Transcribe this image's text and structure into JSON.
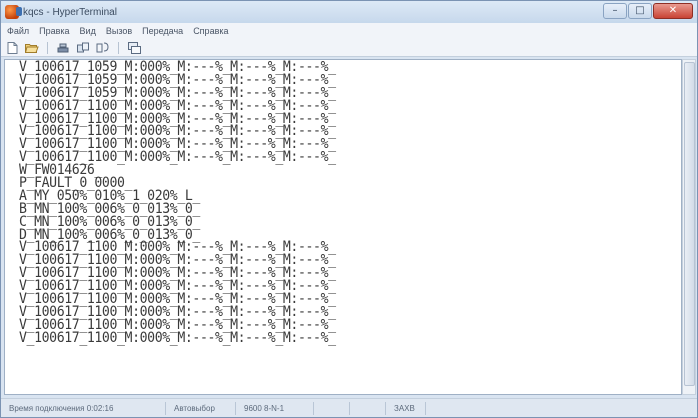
{
  "window": {
    "title": "kqcs - HyperTerminal"
  },
  "menu": [
    "Файл",
    "Правка",
    "Вид",
    "Вызов",
    "Передача",
    "Справка"
  ],
  "toolbar": {
    "icons": [
      "new-icon",
      "open-icon",
      "disconnect-icon",
      "call-icon",
      "send-icon",
      "properties-icon"
    ]
  },
  "terminal": {
    "lines": [
      "V_100617_1059_M:000%_M:---%_M:---%_M:---%_",
      "V_100617_1059_M:000%_M:---%_M:---%_M:---%_",
      "V_100617_1059_M:000%_M:---%_M:---%_M:---%_",
      "V_100617_1100_M:000%_M:---%_M:---%_M:---%_",
      "V_100617_1100_M:000%_M:---%_M:---%_M:---%_",
      "V_100617_1100_M:000%_M:---%_M:---%_M:---%_",
      "V_100617_1100_M:000%_M:---%_M:---%_M:---%_",
      "V_100617_1100_M:000%_M:---%_M:---%_M:---%_",
      "W_FW014626_",
      "P_FAULT_0_0000_",
      "A_MY_050%_010%_1_020%_L_",
      "B_MN_100%_006%_0_013%_0_",
      "C_MN_100%_006%_0_013%_0_",
      "D_MN_100%_006%_0_013%_0_",
      "V_100617_1100_M:000%_M:---%_M:---%_M:---%_",
      "V_100617_1100_M:000%_M:---%_M:---%_M:---%_",
      "V_100617_1100_M:000%_M:---%_M:---%_M:---%_",
      "V_100617_1100_M:000%_M:---%_M:---%_M:---%_",
      "V_100617_1100_M:000%_M:---%_M:---%_M:---%_",
      "V_100617_1100_M:000%_M:---%_M:---%_M:---%_",
      "V_100617_1100_M:000%_M:---%_M:---%_M:---%_",
      "V_100617_1100_M:000%_M:---%_M:---%_M:---%_"
    ]
  },
  "statusbar": {
    "cells": [
      "Время подключения 0:02:16",
      "Автовыбор",
      "9600 8-N-1",
      "",
      "",
      "ЗАХВ",
      ""
    ]
  }
}
